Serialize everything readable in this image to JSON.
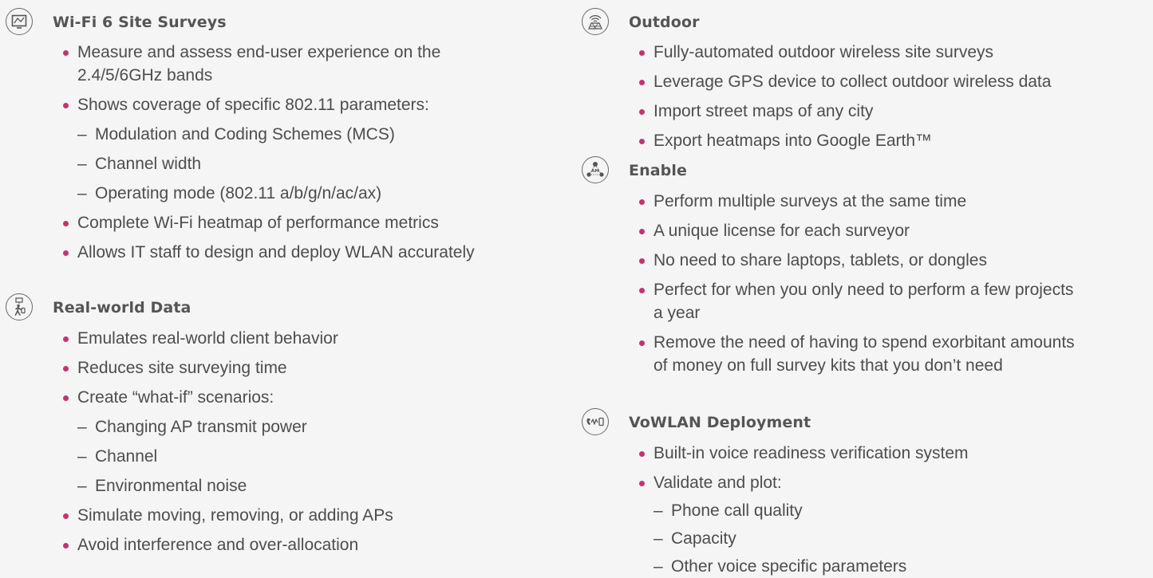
{
  "sections": [
    {
      "icon": "monitor-icon",
      "title": "Wi-Fi 6 Site Surveys",
      "items": [
        {
          "text": "Measure and assess end-user experience on the"
        },
        {
          "text": "2.4/5/6GHz bands",
          "cont": true
        },
        {
          "text": "Shows coverage of specific 802.11 parameters:"
        },
        {
          "text": "Modulation and Coding Schemes (MCS)",
          "sub": true
        },
        {
          "text": "Channel width",
          "sub": true
        },
        {
          "text": "Operating mode (802.11 a/b/g/n/ac/ax)",
          "sub": true
        },
        {
          "text": "Complete Wi-Fi heatmap of performance metrics"
        },
        {
          "text": "Allows IT staff to design and deploy WLAN accurately"
        }
      ]
    },
    {
      "icon": "walking-person-icon",
      "title": "Real-world Data",
      "items": [
        {
          "text": "Emulates real-world client behavior"
        },
        {
          "text": "Reduces site surveying time"
        },
        {
          "text": "Create “what-if” scenarios:"
        },
        {
          "text": "Changing AP transmit power",
          "sub": true
        },
        {
          "text": "Channel",
          "sub": true
        },
        {
          "text": "Environmental noise",
          "sub": true
        },
        {
          "text": "Simulate moving, removing, or adding APs"
        },
        {
          "text": "Avoid interference and over-allocation"
        }
      ]
    },
    {
      "icon": "outdoor-signal-map-icon",
      "title": "Outdoor",
      "items": [
        {
          "text": "Fully-automated outdoor wireless site surveys"
        },
        {
          "text": "Leverage GPS device to collect outdoor wireless data"
        },
        {
          "text": "Import street maps of any city"
        },
        {
          "text": "Export heatmaps into Google Earth™"
        }
      ]
    },
    {
      "icon": "network-nodes-icon",
      "title": "Enable",
      "items": [
        {
          "text": "Perform multiple surveys at the same time"
        },
        {
          "text": "A unique license for each surveyor"
        },
        {
          "text": "No need to share laptops, tablets, or dongles"
        },
        {
          "text": "Perfect for when you only need to perform a few projects"
        },
        {
          "text": "a year",
          "cont": true
        },
        {
          "text": "Remove the need of having to spend exorbitant amounts"
        },
        {
          "text": "of money on full survey kits that you don’t need",
          "cont": true
        }
      ]
    },
    {
      "icon": "voice-wave-icon",
      "title": "VoWLAN Deployment",
      "items": [
        {
          "text": "Built-in voice readiness verification system"
        },
        {
          "text": "Validate and plot:"
        },
        {
          "text": "Phone call quality",
          "sub": true
        },
        {
          "text": "Capacity",
          "sub": true
        },
        {
          "text": "Other voice specific parameters",
          "sub": true
        }
      ]
    }
  ],
  "dash_glyph": "–"
}
